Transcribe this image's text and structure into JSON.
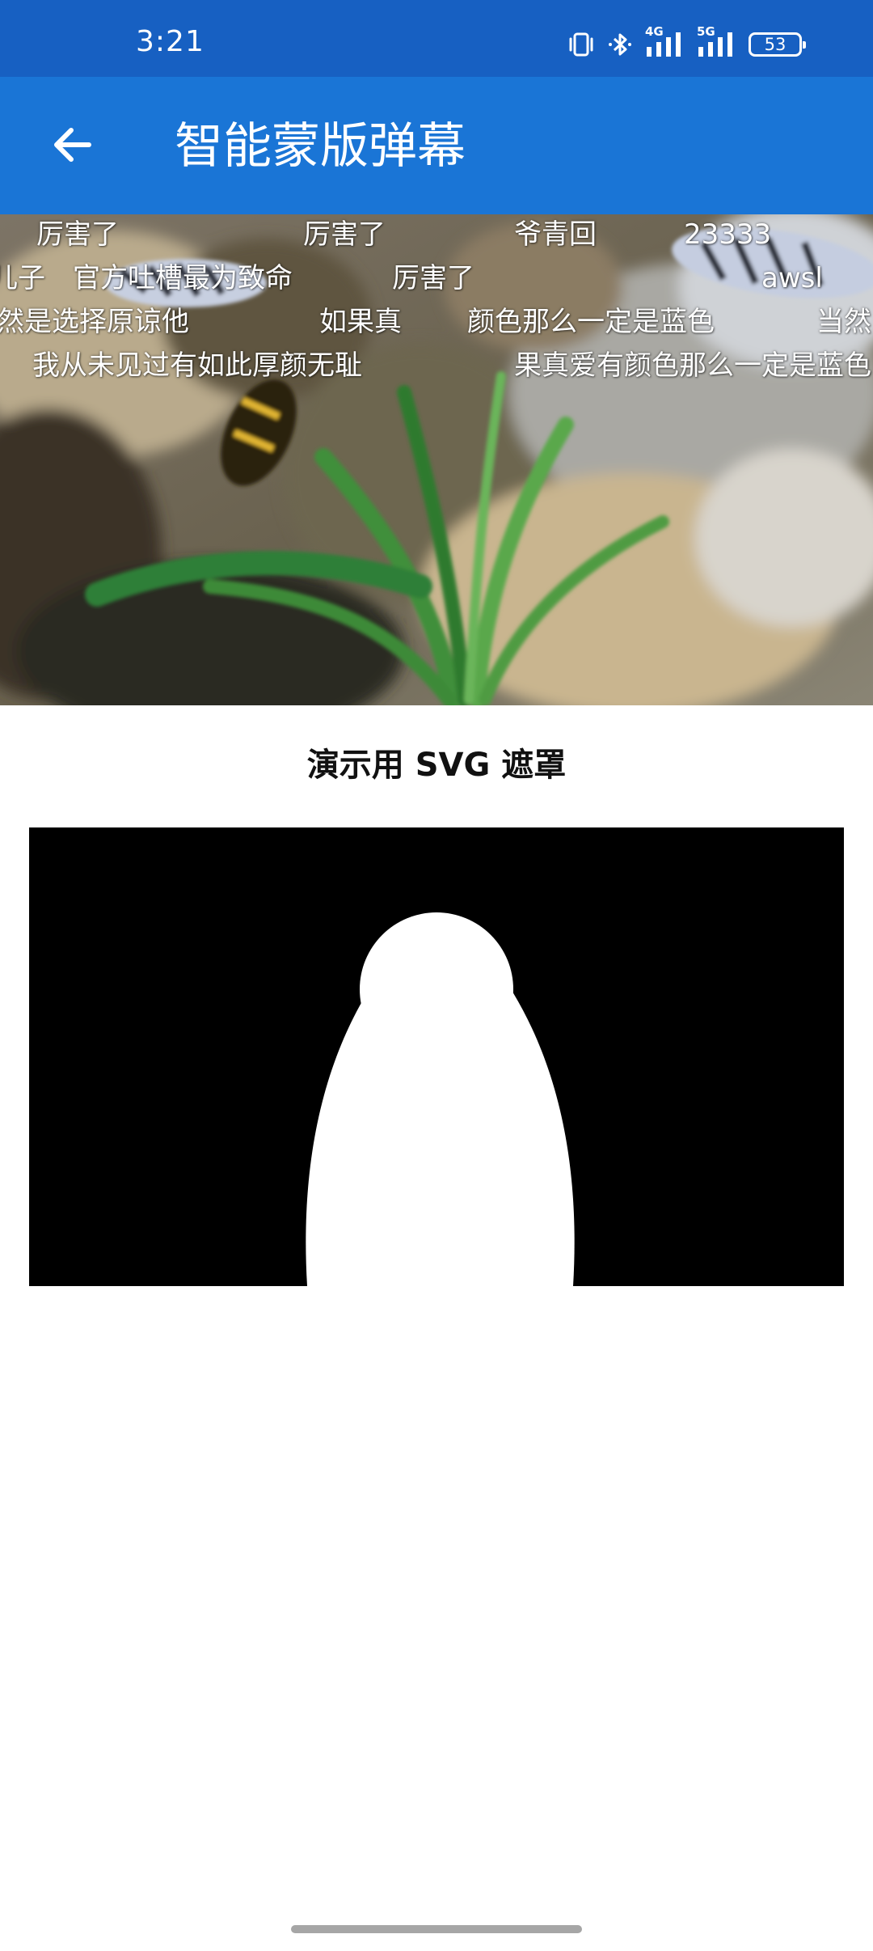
{
  "status_bar": {
    "time": "3:21",
    "network_1": "4G",
    "network_2": "5G",
    "battery": "53",
    "icons": [
      "vibrate-icon",
      "bluetooth-icon",
      "signal-4g-icon",
      "signal-5g-icon",
      "battery-icon"
    ]
  },
  "app_bar": {
    "title": "智能蒙版弹幕",
    "back_icon": "arrow-left-icon"
  },
  "danmaku": {
    "row1": [
      "厉害了",
      "厉害了",
      "爷青回",
      "23333"
    ],
    "row2": [
      "儿子",
      "官方吐槽最为致命",
      "厉害了",
      "awsl"
    ],
    "row3": [
      "然是选择原谅他",
      "如果真",
      "颜色那么一定是蓝色",
      "当然"
    ],
    "row4": [
      "我从未见过有如此厚颜无耻",
      "果真爱有颜色那么一定是蓝色"
    ]
  },
  "mask_section": {
    "caption": "演示用 SVG 遮罩"
  },
  "colors": {
    "status_bar": "#1760c2",
    "app_bar": "#1a75d6",
    "mask_background": "#000000",
    "mask_shape": "#ffffff"
  }
}
